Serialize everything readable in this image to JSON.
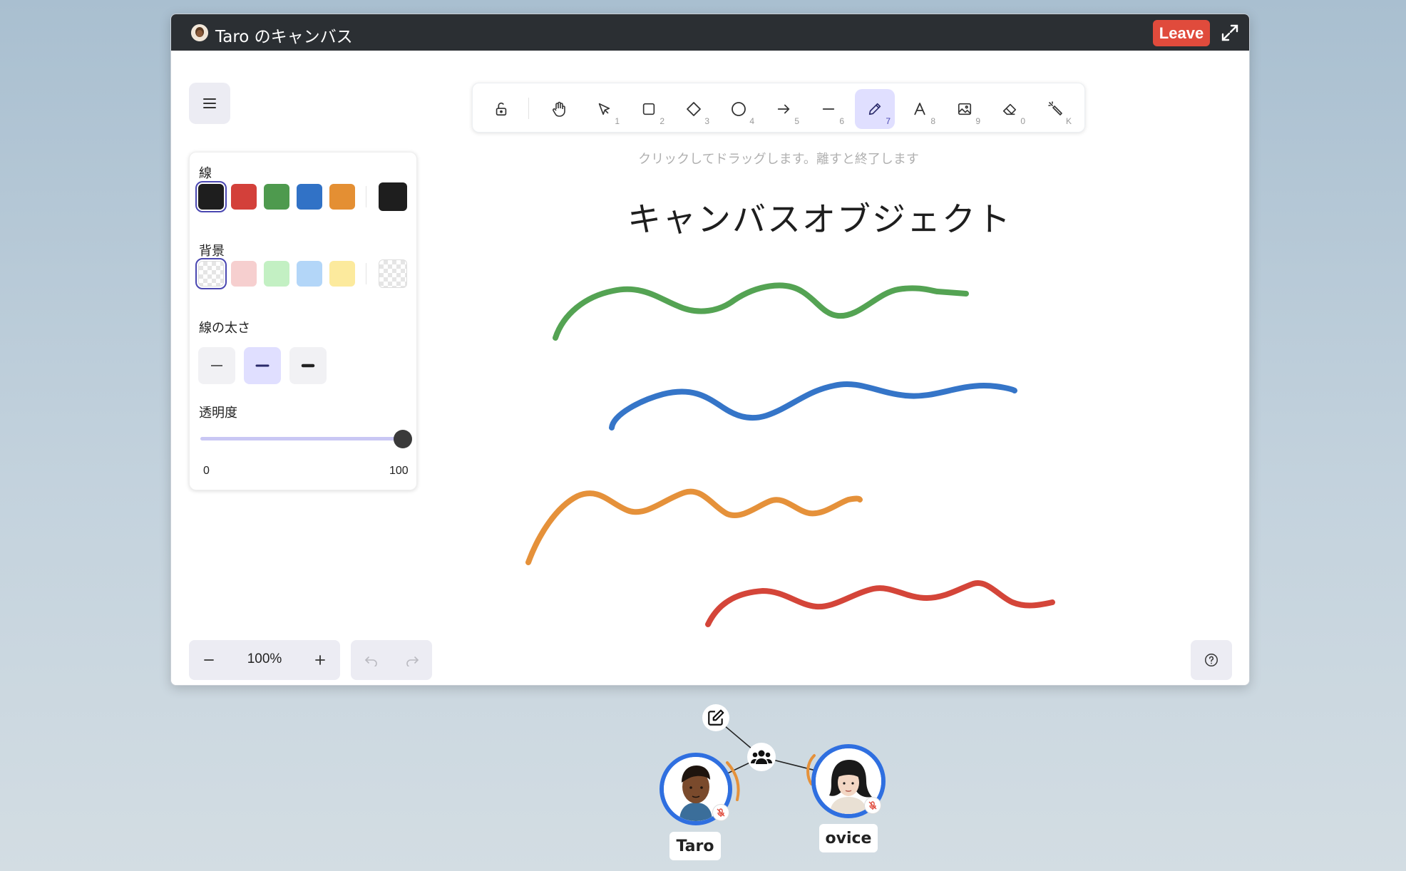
{
  "window": {
    "title": "Taro のキャンバス",
    "leave_label": "Leave"
  },
  "toolbar": {
    "tools": [
      {
        "name": "lock",
        "key": ""
      },
      {
        "name": "hand",
        "key": ""
      },
      {
        "name": "selection",
        "key": "1"
      },
      {
        "name": "rectangle",
        "key": "2"
      },
      {
        "name": "diamond",
        "key": "3"
      },
      {
        "name": "ellipse",
        "key": "4"
      },
      {
        "name": "arrow",
        "key": "5"
      },
      {
        "name": "line",
        "key": "6"
      },
      {
        "name": "draw",
        "key": "7",
        "active": true
      },
      {
        "name": "text",
        "key": "8"
      },
      {
        "name": "image",
        "key": "9"
      },
      {
        "name": "eraser",
        "key": "0"
      },
      {
        "name": "laser",
        "key": "K"
      }
    ],
    "hint": "クリックしてドラッグします。離すと終了します"
  },
  "properties": {
    "stroke_label": "線",
    "stroke_colors": [
      "#1e1e1e",
      "#d3403a",
      "#4e9a4e",
      "#3172c6",
      "#e48f33"
    ],
    "stroke_current": "#1e1e1e",
    "background_label": "背景",
    "background_colors": [
      "transparent",
      "#f6cfcf",
      "#c3f0c3",
      "#b3d6f8",
      "#fcea9d"
    ],
    "background_current": "transparent",
    "stroke_width_label": "線の太さ",
    "opacity_label": "透明度",
    "opacity_min": "0",
    "opacity_max": "100",
    "opacity_value": 100
  },
  "canvas": {
    "title_text": "キャンバスオブジェクト",
    "stroke_colors": {
      "green": "#54a353",
      "blue": "#3575c8",
      "orange": "#e5913a",
      "red": "#d44539"
    }
  },
  "footer": {
    "zoom": "100%"
  },
  "participants": [
    {
      "name": "Taro"
    },
    {
      "name": "ovice"
    }
  ],
  "colors": {
    "accent": "#e0dfff",
    "leave": "#e04b3c",
    "avatar_ring": "#2f6fe0"
  }
}
